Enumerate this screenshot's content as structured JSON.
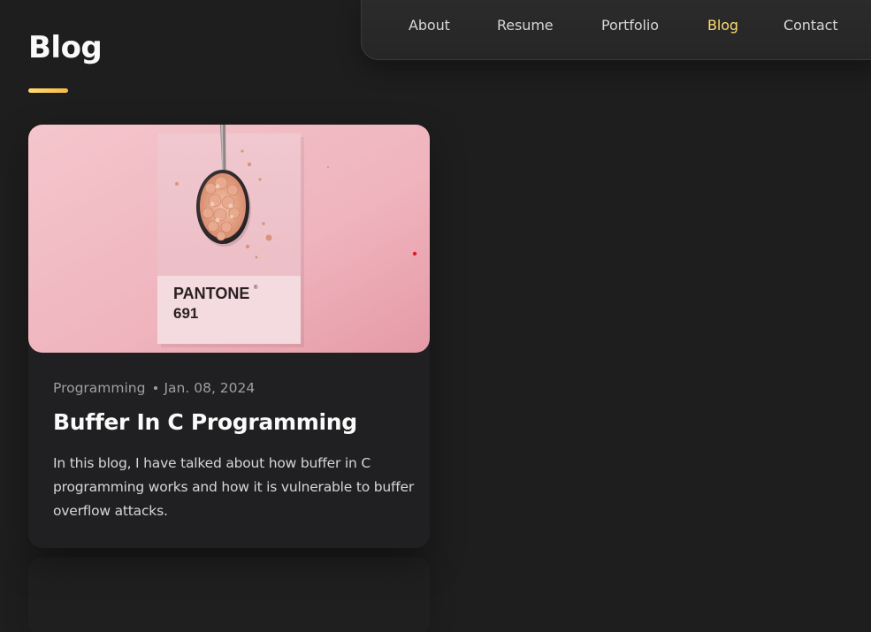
{
  "nav": {
    "items": [
      {
        "label": "About",
        "active": false
      },
      {
        "label": "Resume",
        "active": false
      },
      {
        "label": "Portfolio",
        "active": false
      },
      {
        "label": "Blog",
        "active": true
      },
      {
        "label": "Contact",
        "active": false
      }
    ]
  },
  "page": {
    "title": "Blog"
  },
  "posts": [
    {
      "category": "Programming",
      "date": "Jan. 08, 2024",
      "title": "Buffer In C Programming",
      "excerpt": "In this blog, I have talked about how buffer in C programming works and how it is vulnerable to buffer overflow attacks.",
      "image": {
        "card_brand": "PANTONE",
        "card_number": "691"
      }
    }
  ],
  "colors": {
    "background": "#1e1e1f",
    "accent": "#ffdb70",
    "card": "#202022",
    "image_pink": "#f3c1c8"
  }
}
